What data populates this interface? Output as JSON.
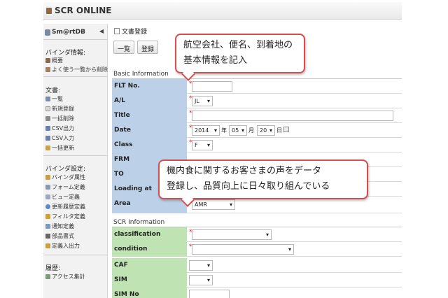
{
  "app": {
    "title": "SCR ONLINE"
  },
  "sidebar": {
    "db_name": "Sm@rtDB",
    "binder_title": "バインダ情報:",
    "binder_items": [
      "概要",
      "よく使う一覧から削除"
    ],
    "doc_title": "文書:",
    "doc_items": [
      "一覧",
      "新規登録",
      "一括削除",
      "CSV出力",
      "CSV入力",
      "一括更新"
    ],
    "settings_title": "バインダ設定:",
    "settings_items": [
      "バインダ属性",
      "フォーム定義",
      "ビュー定義",
      "更新履歴定義",
      "フィルタ定義",
      "通知定義",
      "部品書式",
      "定義入出力"
    ],
    "history_title": "履歴:",
    "history_items": [
      "アクセス集計"
    ]
  },
  "page": {
    "heading": "文書登録",
    "btn_list": "一覧",
    "btn_register": "登録"
  },
  "basic": {
    "title": "Basic Information",
    "flt_label": "FLT No.",
    "al_label": "A/L",
    "al_value": "JL",
    "title_label": "Title",
    "date_label": "Date",
    "date_year": "2014",
    "year_unit": "年",
    "date_month": "05",
    "month_unit": "月",
    "date_day": "20",
    "day_unit": "日",
    "class_label": "Class",
    "class_value": "F",
    "frm_label": "FRM",
    "to_label": "TO",
    "loading_label": "Loading at",
    "area_label": "Area",
    "area_value": "AMR"
  },
  "scr": {
    "title": "SCR Information",
    "classification_label": "classification",
    "condition_label": "condition",
    "caf_label": "CAF",
    "sim_label": "SIM",
    "simno_label": "SIM No"
  },
  "callouts": {
    "top_line1": "航空会社、便名、到着地の",
    "top_line2": "基本情報を記入",
    "mid_line1": "機内食に関するお客さまの声をデータ",
    "mid_line2": "登録し、品質向上に日々取り組んでいる"
  },
  "colors": {
    "label_blue": "#bcd0e8",
    "label_green": "#bfe3b2",
    "required": "#d22222",
    "callout_border": "#d84c4c"
  }
}
